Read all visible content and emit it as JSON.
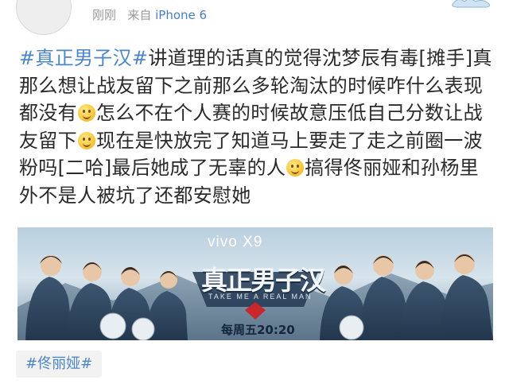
{
  "post": {
    "time": "刚刚",
    "source_prefix": "来自",
    "source_device": "iPhone 6",
    "hashtag": "#真正男子汉#",
    "line1": "讲道理的话真的觉得沈梦辰有毒[摊手]真",
    "line2": "那么想让战友留下之前那么多轮淘汰的时候咋什么表现",
    "line3a": "都没有",
    "line3b": "怎么不在个人赛的时候故意压低自己分数让战",
    "line4a": "友留下",
    "line4b": "现在是快放完了知道马上要走了走之前圈一波",
    "line5a": "粉吗[二哈]最后她成了无辜的人",
    "line5b": "搞得佟丽娅和孙杨里",
    "line6": "外不是人被坑了还都安慰她"
  },
  "banner": {
    "sponsor": "vivo X9",
    "show_title": "真正男子汉",
    "subtitle": "TAKE ME A REAL MAN",
    "schedule": "每周五20:20"
  },
  "tag": {
    "label": "#佟丽娅#"
  },
  "colors": {
    "link": "#4c86c5",
    "meta": "#9a9a9a"
  },
  "icons": {
    "avatar": "avatar-icon",
    "emoji": "smile-emoji-icon",
    "deco": "cloud-decoration-icon"
  }
}
